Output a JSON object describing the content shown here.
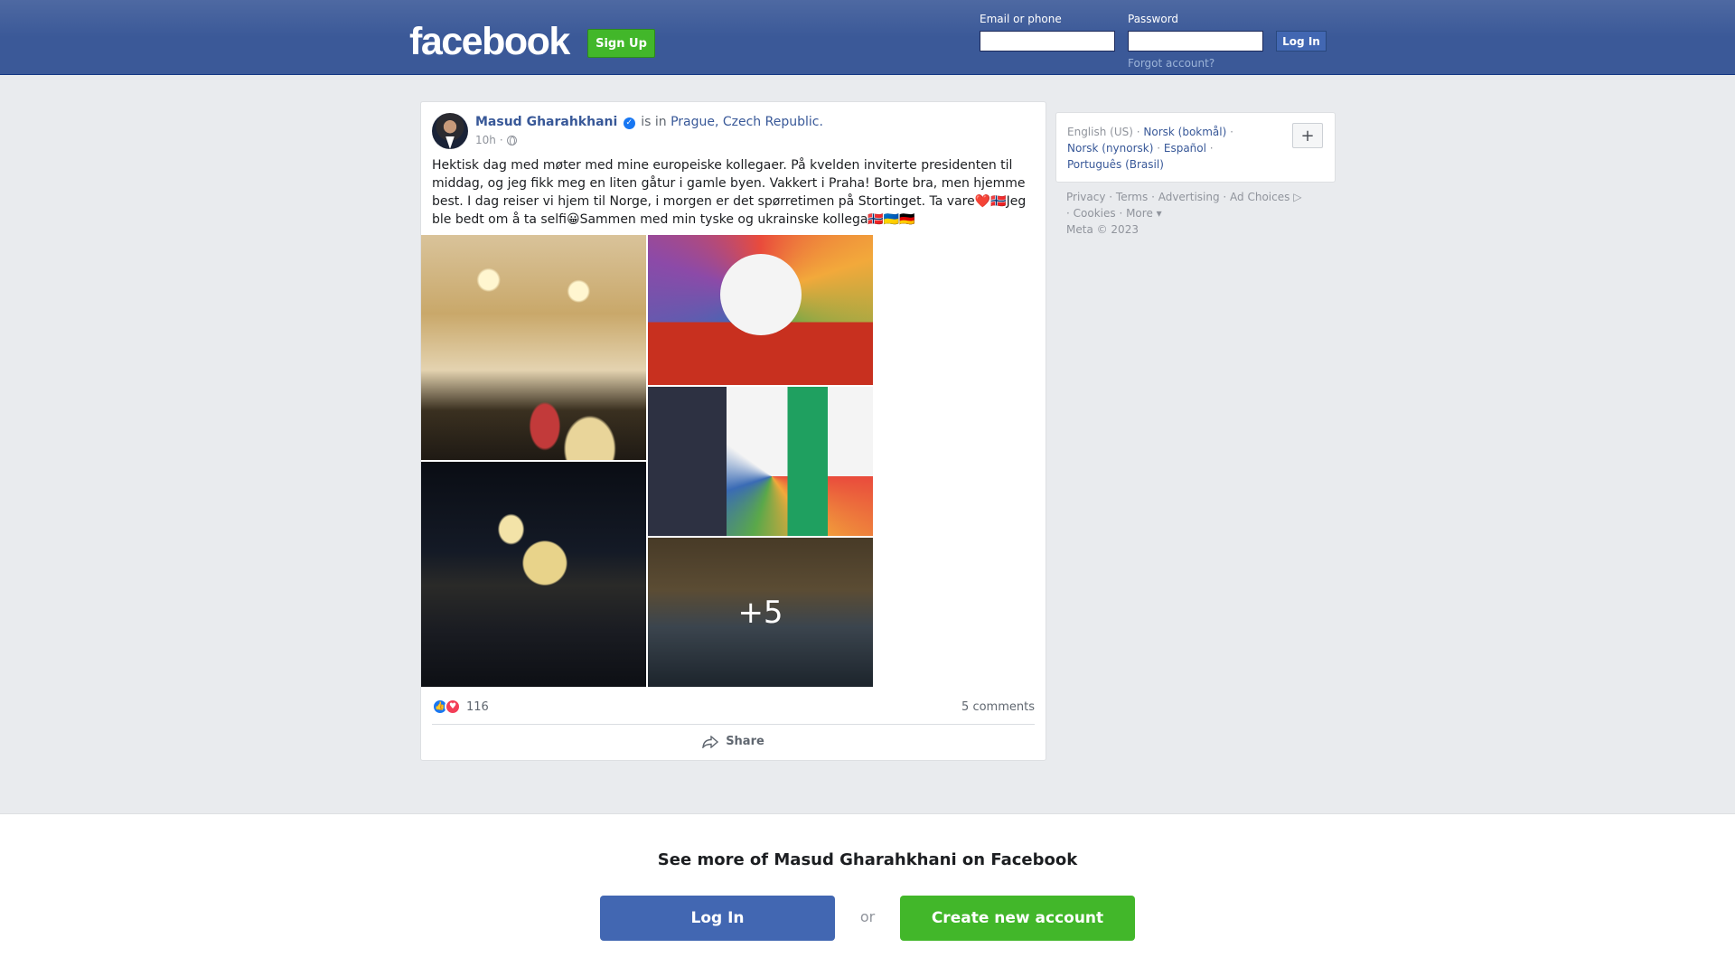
{
  "header": {
    "logo": "facebook",
    "signup_label": "Sign Up",
    "email_label": "Email or phone",
    "password_label": "Password",
    "login_label": "Log In",
    "forgot_label": "Forgot account?"
  },
  "post": {
    "author": "Masud Gharahkhani",
    "is_in": "is in",
    "location": "Prague, Czech Republic.",
    "time": "10h",
    "separator": "·",
    "privacy_icon": "globe-icon",
    "text": "Hektisk dag med møter med mine europeiske kollegaer. På kvelden inviterte presidenten til middag, og jeg fikk meg en liten gåtur i gamle byen. Vakkert i Praha! Borte bra, men hjemme best. I dag reiser vi hjem til Norge, i morgen er det spørretimen på Stortinget. Ta vare❤️🇳🇴Jeg ble bedt om å ta selfi😀Sammen med min tyske og ukrainske kollega🇳🇴🇺🇦🇩🇪",
    "more_photos": "+5",
    "reaction_count": "116",
    "comments": "5 comments",
    "share_label": "Share"
  },
  "sidebar": {
    "current_language": "English (US)",
    "languages": [
      "Norsk (bokmål)",
      "Norsk (nynorsk)",
      "Español",
      "Português (Brasil)"
    ],
    "add_language": "+",
    "footer_links": [
      "Privacy",
      "Terms",
      "Advertising",
      "Ad Choices",
      "Cookies",
      "More"
    ],
    "copyright": "Meta © 2023"
  },
  "banner": {
    "title": "See more of Masud Gharahkhani on Facebook",
    "login_label": "Log In",
    "or": "or",
    "create_label": "Create new account"
  },
  "colors": {
    "brand_blue": "#3b5998",
    "green": "#42b72a",
    "link": "#385898"
  }
}
